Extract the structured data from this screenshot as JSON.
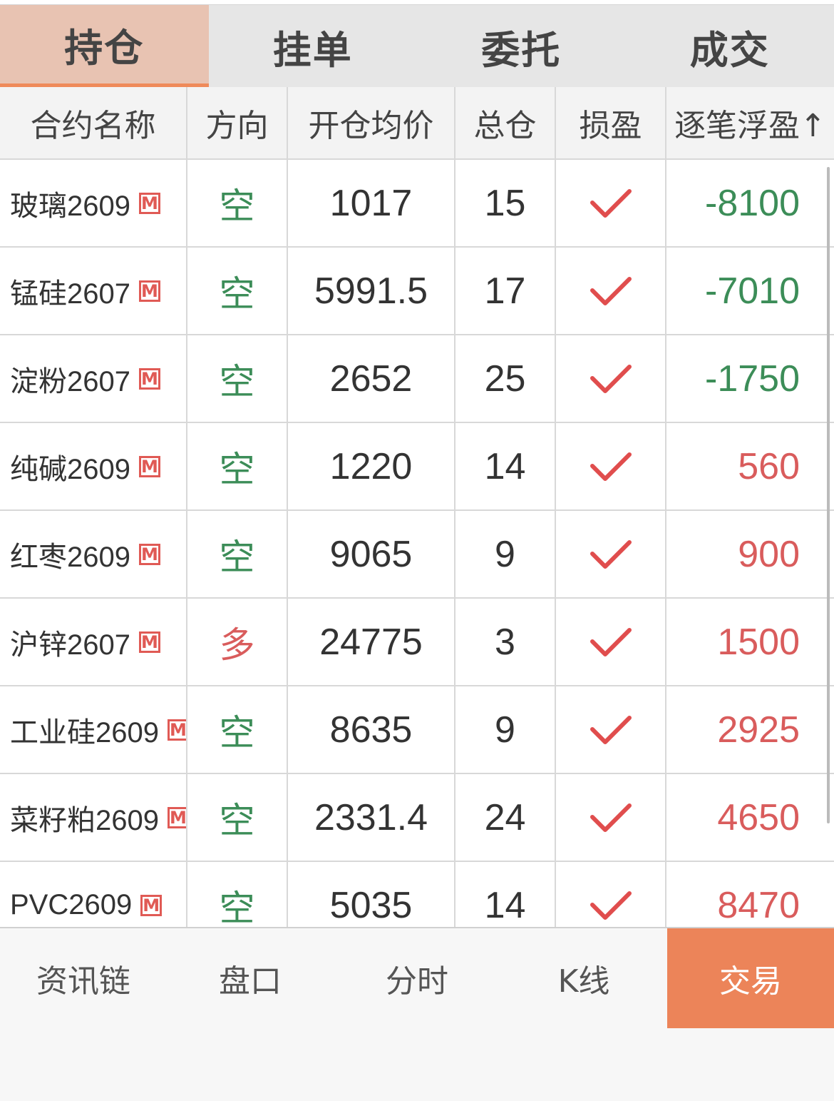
{
  "top_tabs": [
    {
      "label": "持仓",
      "active": true
    },
    {
      "label": "挂单",
      "active": false
    },
    {
      "label": "委托",
      "active": false
    },
    {
      "label": "成交",
      "active": false
    }
  ],
  "columns": [
    "合约名称",
    "方向",
    "开仓均价",
    "总仓",
    "损盈",
    "逐笔浮盈↑"
  ],
  "badge": "M",
  "positions": [
    {
      "name": "玻璃2609",
      "direction": "空",
      "avg_price": "1017",
      "total": "15",
      "pnl": "-8100",
      "pnl_sign": "neg"
    },
    {
      "name": "锰硅2607",
      "direction": "空",
      "avg_price": "5991.5",
      "total": "17",
      "pnl": "-7010",
      "pnl_sign": "neg"
    },
    {
      "name": "淀粉2607",
      "direction": "空",
      "avg_price": "2652",
      "total": "25",
      "pnl": "-1750",
      "pnl_sign": "neg"
    },
    {
      "name": "纯碱2609",
      "direction": "空",
      "avg_price": "1220",
      "total": "14",
      "pnl": "560",
      "pnl_sign": "pos"
    },
    {
      "name": "红枣2609",
      "direction": "空",
      "avg_price": "9065",
      "total": "9",
      "pnl": "900",
      "pnl_sign": "pos"
    },
    {
      "name": "沪锌2607",
      "direction": "多",
      "avg_price": "24775",
      "total": "3",
      "pnl": "1500",
      "pnl_sign": "pos"
    },
    {
      "name": "工业硅2609",
      "direction": "空",
      "avg_price": "8635",
      "total": "9",
      "pnl": "2925",
      "pnl_sign": "pos"
    },
    {
      "name": "菜籽粕2609",
      "direction": "空",
      "avg_price": "2331.4",
      "total": "24",
      "pnl": "4650",
      "pnl_sign": "pos"
    },
    {
      "name": "PVC2609",
      "direction": "空",
      "avg_price": "5035",
      "total": "14",
      "pnl": "8470",
      "pnl_sign": "pos"
    }
  ],
  "bottom_nav": [
    {
      "label": "资讯链",
      "active": false
    },
    {
      "label": "盘口",
      "active": false
    },
    {
      "label": "分时",
      "active": false
    },
    {
      "label": "K线",
      "active": false
    },
    {
      "label": "交易",
      "active": true
    }
  ],
  "colors": {
    "accent": "#ec8459",
    "active_tab_bg": "#e8c3b2",
    "short_green": "#3c8d58",
    "long_red": "#d95c5c",
    "loss_green": "#3c8d58",
    "profit_red": "#d95c5c"
  },
  "icons": {
    "check": "check-icon",
    "badge": "m-badge-icon"
  }
}
